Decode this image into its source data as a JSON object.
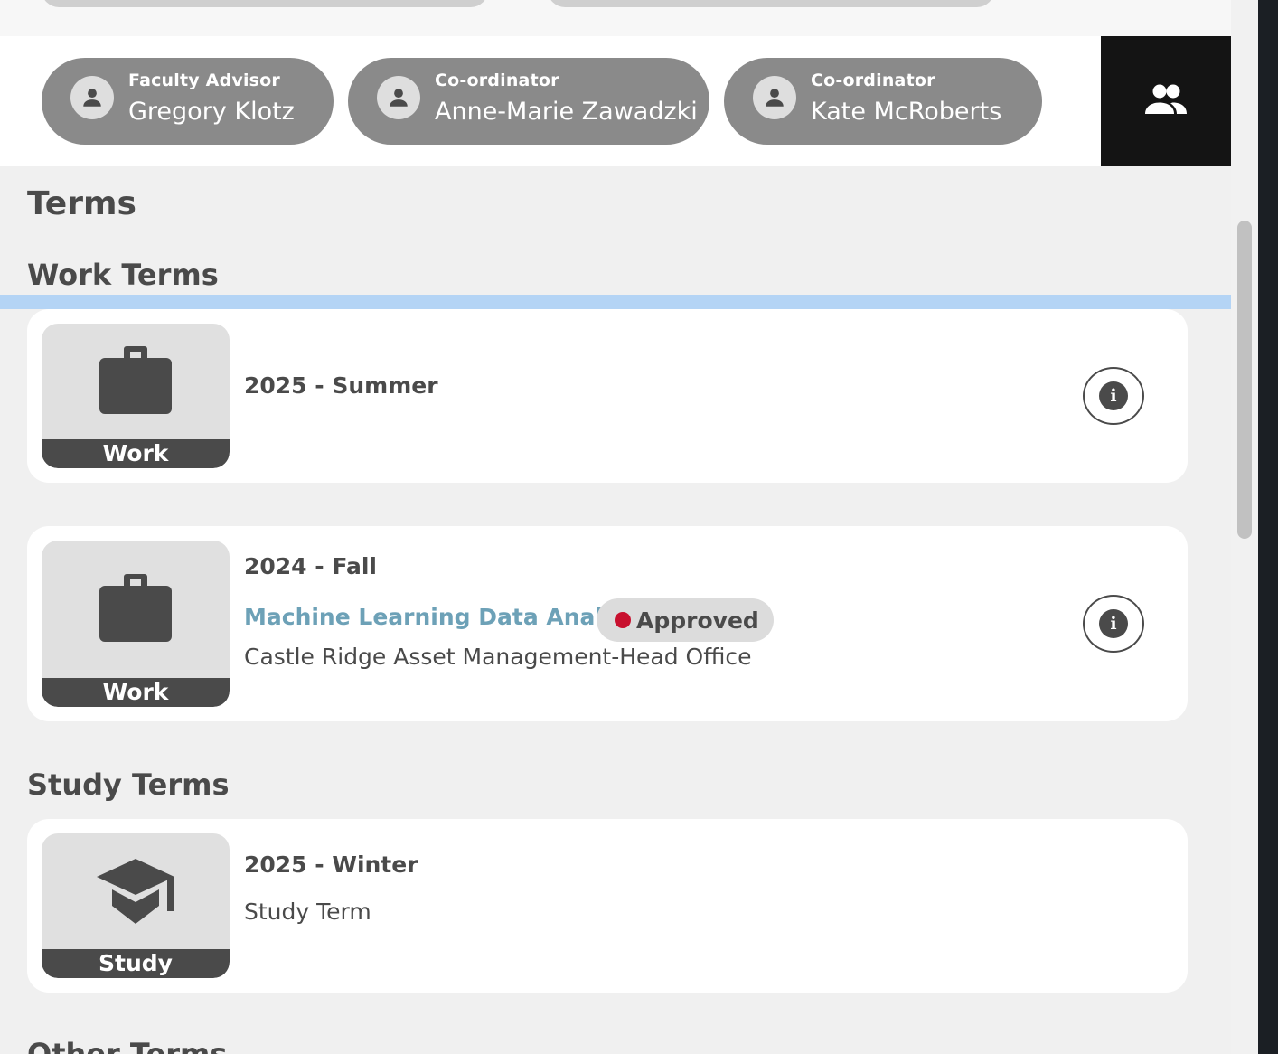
{
  "contacts": [
    {
      "role": "Faculty Advisor",
      "name": "Gregory Klotz"
    },
    {
      "role": "Co-ordinator",
      "name": "Anne-Marie Zawadzki"
    },
    {
      "role": "Co-ordinator",
      "name": "Kate McRoberts"
    }
  ],
  "icons": {
    "avatar": "person-icon",
    "contacts_toggle": "group-icon",
    "work": "briefcase-icon",
    "study": "graduation-cap-icon",
    "info": "info-icon"
  },
  "terms": {
    "heading": "Terms",
    "work": {
      "heading": "Work Terms",
      "items": [
        {
          "tile_label": "Work",
          "title": "2025 - Summer"
        },
        {
          "tile_label": "Work",
          "title": "2024 - Fall",
          "job_title": "Machine Learning Data Analyst",
          "status": "Approved",
          "employer": "Castle Ridge Asset Management-Head Office"
        }
      ]
    },
    "study": {
      "heading": "Study Terms",
      "items": [
        {
          "tile_label": "Study",
          "title": "2025 - Winter",
          "subtitle": "Study Term"
        }
      ]
    },
    "other": {
      "heading": "Other Terms"
    }
  },
  "colors": {
    "link": "#6da1b7",
    "status_approved": "#c8102e",
    "highlight": "#b4d4f5",
    "dark": "#141414"
  }
}
